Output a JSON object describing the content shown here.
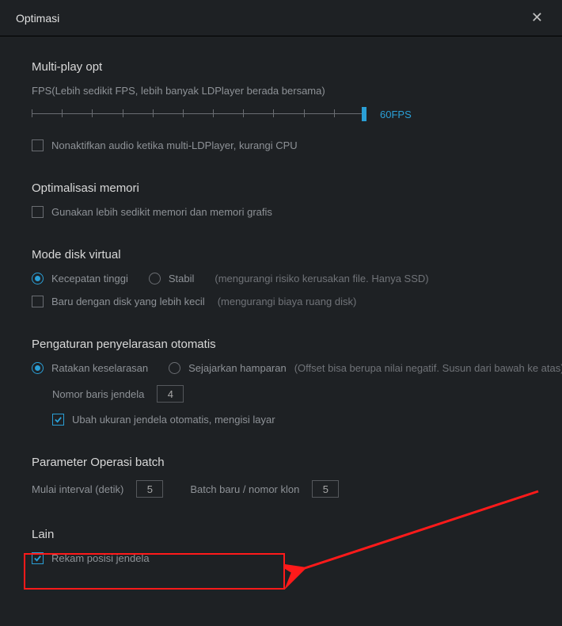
{
  "title": "Optimasi",
  "sections": {
    "multiplay": {
      "title": "Multi-play opt",
      "fps_label": "FPS(Lebih sedikit FPS, lebih banyak LDPlayer berada bersama)",
      "fps_value": "60FPS",
      "disable_audio": "Nonaktifkan audio ketika multi-LDPlayer, kurangi CPU"
    },
    "memory": {
      "title": "Optimalisasi memori",
      "use_less": "Gunakan lebih sedikit memori dan memori grafis"
    },
    "disk": {
      "title": "Mode disk virtual",
      "high_speed": "Kecepatan tinggi",
      "stable": "Stabil",
      "hint1": "(mengurangi risiko kerusakan file. Hanya SSD)",
      "new_smaller": "Baru dengan disk yang lebih kecil",
      "hint2": "(mengurangi biaya ruang disk)"
    },
    "alignment": {
      "title": "Pengaturan penyelarasan otomatis",
      "flatten": "Ratakan keselarasan",
      "align_overlay": "Sejajarkan hamparan",
      "hint_overlay": "(Offset bisa berupa nilai negatif. Susun dari bawah ke atas)",
      "row_num_label": "Nomor baris jendela",
      "row_num_value": "4",
      "auto_resize": "Ubah ukuran jendela otomatis, mengisi layar"
    },
    "batch": {
      "title": "Parameter Operasi batch",
      "start_interval_label": "Mulai interval (detik)",
      "start_interval_value": "5",
      "new_batch_label": "Batch baru / nomor klon",
      "new_batch_value": "5"
    },
    "other": {
      "title": "Lain",
      "record_window": "Rekam posisi jendela"
    }
  }
}
